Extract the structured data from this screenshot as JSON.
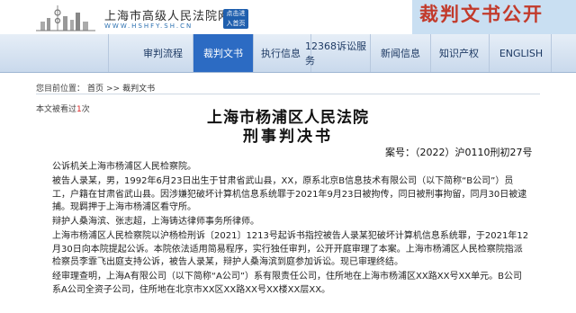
{
  "header": {
    "site_name": "上海市高级人民法院网",
    "site_domain": "WWW.HSHFY.SH.CN",
    "home_badge_line1": "点击进",
    "home_badge_line2": "入首页",
    "banner_title": "裁判文书公开"
  },
  "nav": {
    "items": [
      {
        "label": "审判流程"
      },
      {
        "label": "裁判文书"
      },
      {
        "label": "执行信息"
      },
      {
        "label": "12368诉讼服务"
      },
      {
        "label": "新闻信息"
      },
      {
        "label": "知识产权"
      },
      {
        "label": "ENGLISH"
      }
    ]
  },
  "breadcrumb": {
    "prefix": "您目前位置：",
    "home": "首页",
    "sep": ">>",
    "current": "裁判文书"
  },
  "views": {
    "before": "本文被看过",
    "count": "1",
    "after": "次"
  },
  "document": {
    "court": "上海市杨浦区人民法院",
    "type": "刑事判决书",
    "case_no": "案号：（2022）沪0110刑初27号",
    "paragraphs": [
      "公诉机关上海市杨浦区人民检察院。",
      "被告人录某，男，1992年6月23日出生于甘肃省武山县，XX，原系北京B信息技术有限公司（以下简称“B公司”）员工，户籍在甘肃省武山县。因涉嫌犯破坏计算机信息系统罪于2021年9月23日被拘传，同日被刑事拘留，同月30日被逮捕。现羁押于上海市杨浦区看守所。",
      "辩护人桑海滨、张志超，上海铸达律师事务所律师。",
      "上海市杨浦区人民检察院以沪杨检刑诉〔2021〕1213号起诉书指控被告人录某犯破坏计算机信息系统罪，于2021年12月30日向本院提起公诉。本院依法适用简易程序，实行独任审判，公开开庭审理了本案。上海市杨浦区人民检察院指派检察员李霏飞出庭支持公诉，被告人录某，辩护人桑海滨到庭参加诉讼。现已审理终结。",
      "经审理查明，上海A有限公司（以下简称“A公司”）系有限责任公司，住所地在上海市杨浦区XX路XX号XX单元。B公司系A公司全资子公司，住所地在北京市XX区XX路XX号XX楼XX层XX。"
    ]
  },
  "colors": {
    "nav_active": "#2c6bc3",
    "banner_text": "#c23a2b",
    "banner_bg": "#c9dff2"
  }
}
